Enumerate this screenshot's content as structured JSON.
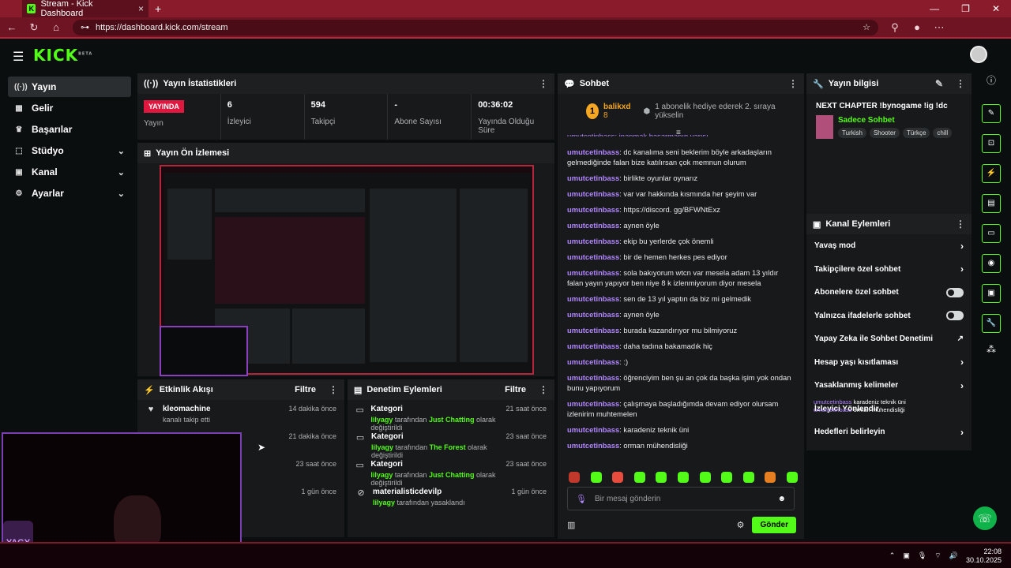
{
  "browser": {
    "tab_title": "Stream - Kick Dashboard",
    "tab_favicon": "K",
    "tab_close": "×",
    "new_tab": "+",
    "window_controls": [
      "—",
      "❐",
      "✕"
    ],
    "url": "https://dashboard.kick.com/stream"
  },
  "app": {
    "logo": "KICK",
    "logo_sup": "BETA",
    "accent": "#53fc18"
  },
  "sidenav": [
    {
      "label": "Yayın",
      "icon": "broadcast-icon",
      "glyph": "((·))",
      "chev": ""
    },
    {
      "label": "Gelir",
      "icon": "revenue-icon",
      "glyph": "▦",
      "chev": ""
    },
    {
      "label": "Başarılar",
      "icon": "trophy-icon",
      "glyph": "♛",
      "chev": ""
    },
    {
      "label": "Stüdyo",
      "icon": "studio-icon",
      "glyph": "⬚",
      "chev": "⌄"
    },
    {
      "label": "Kanal",
      "icon": "channel-icon",
      "glyph": "▣",
      "chev": "⌄"
    },
    {
      "label": "Ayarlar",
      "icon": "settings-icon",
      "glyph": "⚙",
      "chev": "⌄"
    }
  ],
  "stats": {
    "title": "Yayın İstatistikleri",
    "live_badge": "YAYINDA",
    "live_label": "Yayın",
    "items": [
      {
        "value": "6",
        "label": "İzleyici"
      },
      {
        "value": "594",
        "label": "Takipçi"
      },
      {
        "value": "-",
        "label": "Abone Sayısı"
      },
      {
        "value": "00:36:02",
        "label": "Yayında Olduğu Süre"
      }
    ]
  },
  "preview": {
    "title": "Yayın Ön İzlemesi"
  },
  "activity": {
    "title": "Etkinlik Akışı",
    "filter": "Filtre",
    "items": [
      {
        "name": "kleomachine",
        "desc": "kanalı takip etti",
        "time": "14 dakika önce"
      },
      {
        "name": "",
        "desc": "",
        "time": "21 dakika önce"
      },
      {
        "name": "",
        "desc": "",
        "time": "23 saat önce"
      },
      {
        "name": "",
        "desc": "",
        "time": "1 gün önce"
      }
    ]
  },
  "moderation": {
    "title": "Denetim Eylemleri",
    "filter": "Filtre",
    "items": [
      {
        "title": "Kategori",
        "user": "lilyagy",
        "mid": " tarafından ",
        "target": "Just Chatting",
        "end": " olarak değiştirildi",
        "time": "21 saat önce"
      },
      {
        "title": "Kategori",
        "user": "lilyagy",
        "mid": " tarafından ",
        "target": "The Forest",
        "end": " olarak değiştirildi",
        "time": "23 saat önce"
      },
      {
        "title": "Kategori",
        "user": "lilyagy",
        "mid": " tarafından ",
        "target": "Just Chatting",
        "end": " olarak değiştirildi",
        "time": "23 saat önce"
      },
      {
        "title": "materialisticdevilp",
        "user": "lilyagy",
        "mid": " tarafından yasaklandı",
        "target": "",
        "end": "",
        "time": "1 gün önce"
      }
    ]
  },
  "chat": {
    "title": "Sohbet",
    "pinned": {
      "rank": "1",
      "user": "balikxd",
      "count": "8",
      "text": "1 abonelik hediye ederek 2. sıraya yükselin"
    },
    "top_partial": "umutcetinbass: inanmak başarmanın yarısı",
    "messages": [
      {
        "user": "umutcetinbass",
        "text": ": dc kanalıma seni beklerim böyle arkadaşların gelmediğinde falan bize katılırsan çok memnun olurum"
      },
      {
        "user": "umutcetinbass",
        "text": ": birlikte oyunlar oynarız"
      },
      {
        "user": "umutcetinbass",
        "text": ": var var hakkında kısmında her şeyim var"
      },
      {
        "user": "umutcetinbass",
        "text": ": https://discord. gg/BFWNtExz"
      },
      {
        "user": "umutcetinbass",
        "text": ": aynen öyle"
      },
      {
        "user": "umutcetinbass",
        "text": ": ekip bu yerlerde çok önemli"
      },
      {
        "user": "umutcetinbass",
        "text": ": bir de hemen herkes pes ediyor"
      },
      {
        "user": "umutcetinbass",
        "text": ": sola bakıyorum wtcn var mesela adam 13 yıldır falan yayın yapıyor ben niye 8 k izlenmiyorum diyor mesela"
      },
      {
        "user": "umutcetinbass",
        "text": ": sen de 13 yıl yaptın da biz mi gelmedik"
      },
      {
        "user": "umutcetinbass",
        "text": ": aynen öyle"
      },
      {
        "user": "umutcetinbass",
        "text": ": burada kazandırıyor mu bilmiyoruz"
      },
      {
        "user": "umutcetinbass",
        "text": ": daha tadına bakamadık hiç"
      },
      {
        "user": "umutcetinbass",
        "text": ": :)"
      },
      {
        "user": "umutcetinbass",
        "text": ": öğrenciyim ben şu an çok da başka işim yok ondan bunu yapıyorum"
      },
      {
        "user": "umutcetinbass",
        "text": ": çalışmaya başladığımda devam ediyor olursam izlenirim muhtemelen"
      },
      {
        "user": "umutcetinbass",
        "text": ": karadeniz teknik üni"
      },
      {
        "user": "umutcetinbass",
        "text": ": orman mühendisliği"
      }
    ],
    "input_placeholder": "Bir mesaj gönderin",
    "send": "Gönder"
  },
  "info": {
    "title": "Yayın bilgisi",
    "stream_title": "NEXT CHAPTER !bynogame !ig !dc",
    "category": "Sadece Sohbet",
    "tags": [
      "Turkish",
      "Shooter",
      "Türkçe",
      "chill"
    ]
  },
  "channel_actions": {
    "title": "Kanal Eylemleri",
    "items": [
      {
        "label": "Yavaş mod",
        "type": "chevron"
      },
      {
        "label": "Takipçilere özel sohbet",
        "type": "chevron"
      },
      {
        "label": "Abonelere özel sohbet",
        "type": "toggle"
      },
      {
        "label": "Yalnızca ifadelerle sohbet",
        "type": "toggle"
      },
      {
        "label": "Yapay Zeka ile Sohbet Denetimi",
        "type": "link"
      },
      {
        "label": "Hesap yaşı kısıtlaması",
        "type": "chevron"
      },
      {
        "label": "Yasaklanmış kelimeler",
        "type": "chevron"
      },
      {
        "label": "İzleyici Yönlendir",
        "type": "none"
      },
      {
        "label": "Hedefleri belirleyin",
        "type": "chevron"
      }
    ],
    "overlay": {
      "user1": "umutcetinbass",
      "msg1": "karadeniz teknik üni",
      "user2": "umutcetinbass",
      "msg2": "orman mühendisliği"
    }
  },
  "taskbar": {
    "time": "22:08",
    "date": "30.10.2025"
  }
}
